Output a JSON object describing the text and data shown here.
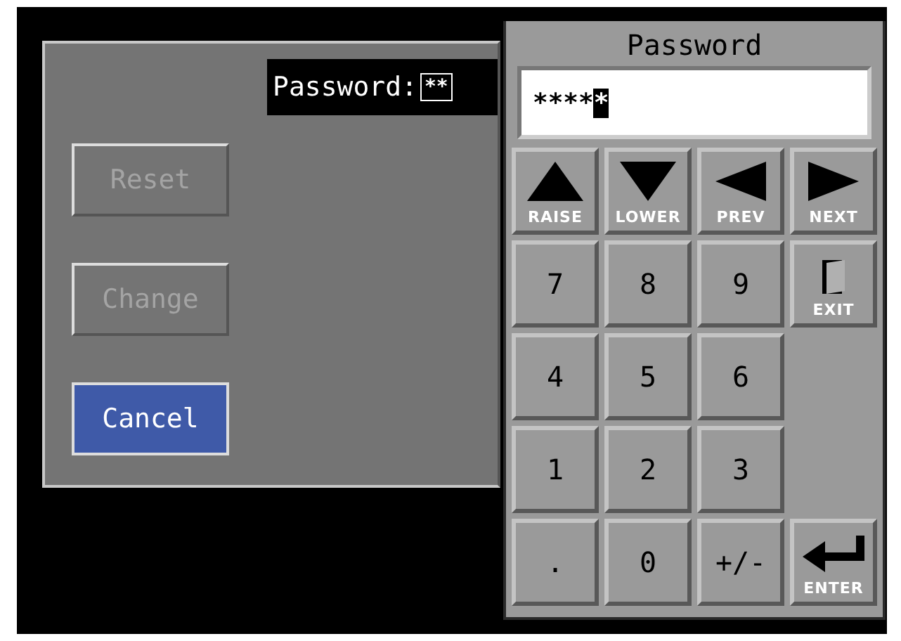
{
  "dialog": {
    "password_label": "Password:",
    "password_value": "**",
    "buttons": [
      {
        "label": "Reset",
        "disabled": true,
        "focused": false
      },
      {
        "label": "Change",
        "disabled": true,
        "focused": false
      },
      {
        "label": "Cancel",
        "disabled": false,
        "focused": true
      }
    ]
  },
  "keypad": {
    "title": "Password",
    "value": "****",
    "cursor": "*",
    "rows": [
      [
        {
          "kind": "up",
          "label": "RAISE"
        },
        {
          "kind": "down",
          "label": "LOWER"
        },
        {
          "kind": "left",
          "label": "PREV"
        },
        {
          "kind": "right",
          "label": "NEXT"
        }
      ],
      [
        {
          "kind": "digit",
          "label": "7"
        },
        {
          "kind": "digit",
          "label": "8"
        },
        {
          "kind": "digit",
          "label": "9"
        },
        {
          "kind": "exit",
          "label": "EXIT"
        }
      ],
      [
        {
          "kind": "digit",
          "label": "4"
        },
        {
          "kind": "digit",
          "label": "5"
        },
        {
          "kind": "digit",
          "label": "6"
        }
      ],
      [
        {
          "kind": "digit",
          "label": "1"
        },
        {
          "kind": "digit",
          "label": "2"
        },
        {
          "kind": "digit",
          "label": "3"
        }
      ],
      [
        {
          "kind": "digit",
          "label": "."
        },
        {
          "kind": "digit",
          "label": "0"
        },
        {
          "kind": "digit",
          "label": "+/-"
        },
        {
          "kind": "enter",
          "label": "ENTER"
        }
      ]
    ]
  }
}
